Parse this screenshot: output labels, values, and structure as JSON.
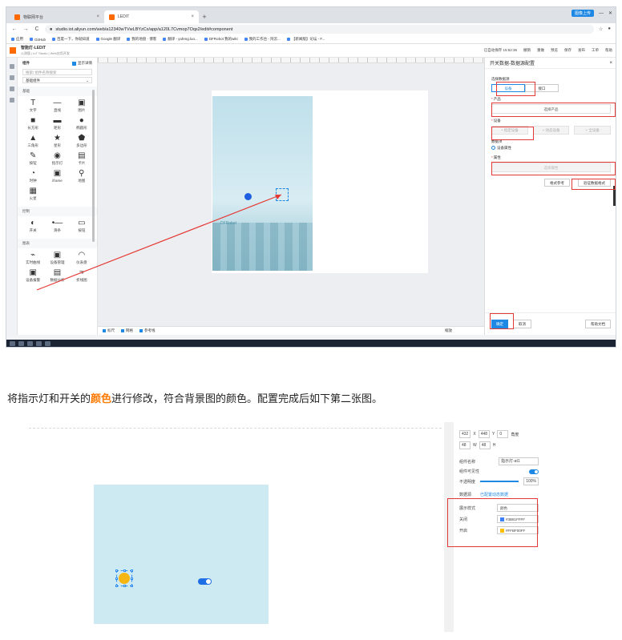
{
  "browser": {
    "tabs": [
      {
        "label": "物联网平台"
      },
      {
        "label": "LEDIT"
      }
    ],
    "new_tab": "+",
    "upload_button": "图像上传",
    "url": "studio.iot.aliyun.com/web/a12340wTVwLBYzCx/app/a120L7Cvmop7Oqs2/edit#component",
    "bookmarks": [
      "应用",
      "GitHub",
      "百度一下，你就知道",
      "Google 翻译",
      "我的地盘 · 博客",
      "翻译 - yufeng.luo...",
      "DFRobot 我的wiki",
      "我的工作台 - 阿云...",
      "【新闻版】论坛 - F..."
    ]
  },
  "app": {
    "title": "智能灯-LEDIT",
    "subtitle": "公测版 | IoT Studio | Web应用开发",
    "save_status": "已自动保存 15:52:36",
    "actions": [
      "撤销",
      "重做",
      "预览",
      "保存",
      "发布",
      "工单",
      "帮助"
    ]
  },
  "components": {
    "header": "组件",
    "toggle_label": "显示详情",
    "search_placeholder": "搜索/ 组件名称搜索",
    "category_select": "基础组件",
    "sections": [
      {
        "title": "基础",
        "items": [
          {
            "label": "文字",
            "glyph": "T"
          },
          {
            "label": "直线",
            "glyph": "—"
          },
          {
            "label": "图片",
            "glyph": "▣"
          },
          {
            "label": "长方形",
            "glyph": "■"
          },
          {
            "label": "矩形",
            "glyph": "▬"
          },
          {
            "label": "椭圆形",
            "glyph": "●"
          },
          {
            "label": "三角形",
            "glyph": "▲"
          },
          {
            "label": "星形",
            "glyph": "★"
          },
          {
            "label": "多边形",
            "glyph": "⬟"
          },
          {
            "label": "按钮",
            "glyph": "✎"
          },
          {
            "label": "指示灯",
            "glyph": "◉"
          },
          {
            "label": "卡片",
            "glyph": "▤"
          },
          {
            "label": "时钟",
            "glyph": "◔"
          },
          {
            "label": "iframe",
            "glyph": "▣"
          },
          {
            "label": "地图",
            "glyph": "⚲"
          },
          {
            "label": "火星",
            "glyph": "▦"
          }
        ]
      },
      {
        "title": "控制",
        "items": [
          {
            "label": "开关",
            "glyph": "◐"
          },
          {
            "label": "滑条",
            "glyph": "•—"
          },
          {
            "label": "按钮",
            "glyph": "▭"
          }
        ]
      },
      {
        "title": "图表",
        "items": [
          {
            "label": "实时曲线",
            "glyph": "⌁"
          },
          {
            "label": "设备管理",
            "glyph": "▣"
          },
          {
            "label": "仪表盘",
            "glyph": "◠"
          },
          {
            "label": "设备报警",
            "glyph": "▣"
          },
          {
            "label": "数据分析",
            "glyph": "▤"
          },
          {
            "label": "折线图",
            "glyph": "≈"
          }
        ]
      }
    ]
  },
  "canvas": {
    "bg_text": "DFRobot",
    "bottom_items": [
      "标尺",
      "网格",
      "参考线"
    ],
    "zoom_label": "缩放"
  },
  "config_panel": {
    "title": "开关数据-数据源配置",
    "close": "×",
    "source_type_label": "选择数据源",
    "source_types": [
      "设备",
      "接口"
    ],
    "product_label": "产品",
    "product_button": "选择产品",
    "device_label": "设备",
    "device_options": [
      "+ 指定设备",
      "+ 动态设备",
      "+ 全设备"
    ],
    "data_item_label": "数据项",
    "data_item_radio": "设备属性",
    "property_label": "属性",
    "property_placeholder": "选择属性",
    "format_ref_button": "格式参考",
    "verify_button": "验证数据格式",
    "confirm_button": "确定",
    "cancel_button": "取消",
    "help_button": "帮助文档"
  },
  "instruction": {
    "before": "将指示灯和开关的",
    "highlight": "颜色",
    "after": "进行修改，符合背景图的颜色。配置完成后如下第二张图。"
  },
  "properties": {
    "pos_x": "432",
    "pos_x_label": "X",
    "pos_y": "448",
    "pos_y_label": "Y",
    "rotation": "0",
    "rotation_label": "角度",
    "width": "48",
    "width_label": "W",
    "height": "48",
    "height_label": "H",
    "name_label": "组件名称",
    "name_value": "指示灯-at1",
    "visible_label": "组件可见性",
    "opacity_label": "不透明度",
    "opacity_value": "100%",
    "datasource_label": "数据源",
    "datasource_link": "已配置动态数据",
    "display_style_label": "展示样式",
    "display_style_value": "颜色",
    "off_label": "关闭",
    "off_color": "#3B81FFFF",
    "on_label": "开启",
    "on_color": "#FFBF00FF"
  },
  "colors": {
    "accent": "#1e88e5",
    "highlight": "#ff7a00",
    "annotation_red": "#e53935",
    "lamp_on": "#f5b614",
    "lamp_off": "#1e5fe0"
  }
}
